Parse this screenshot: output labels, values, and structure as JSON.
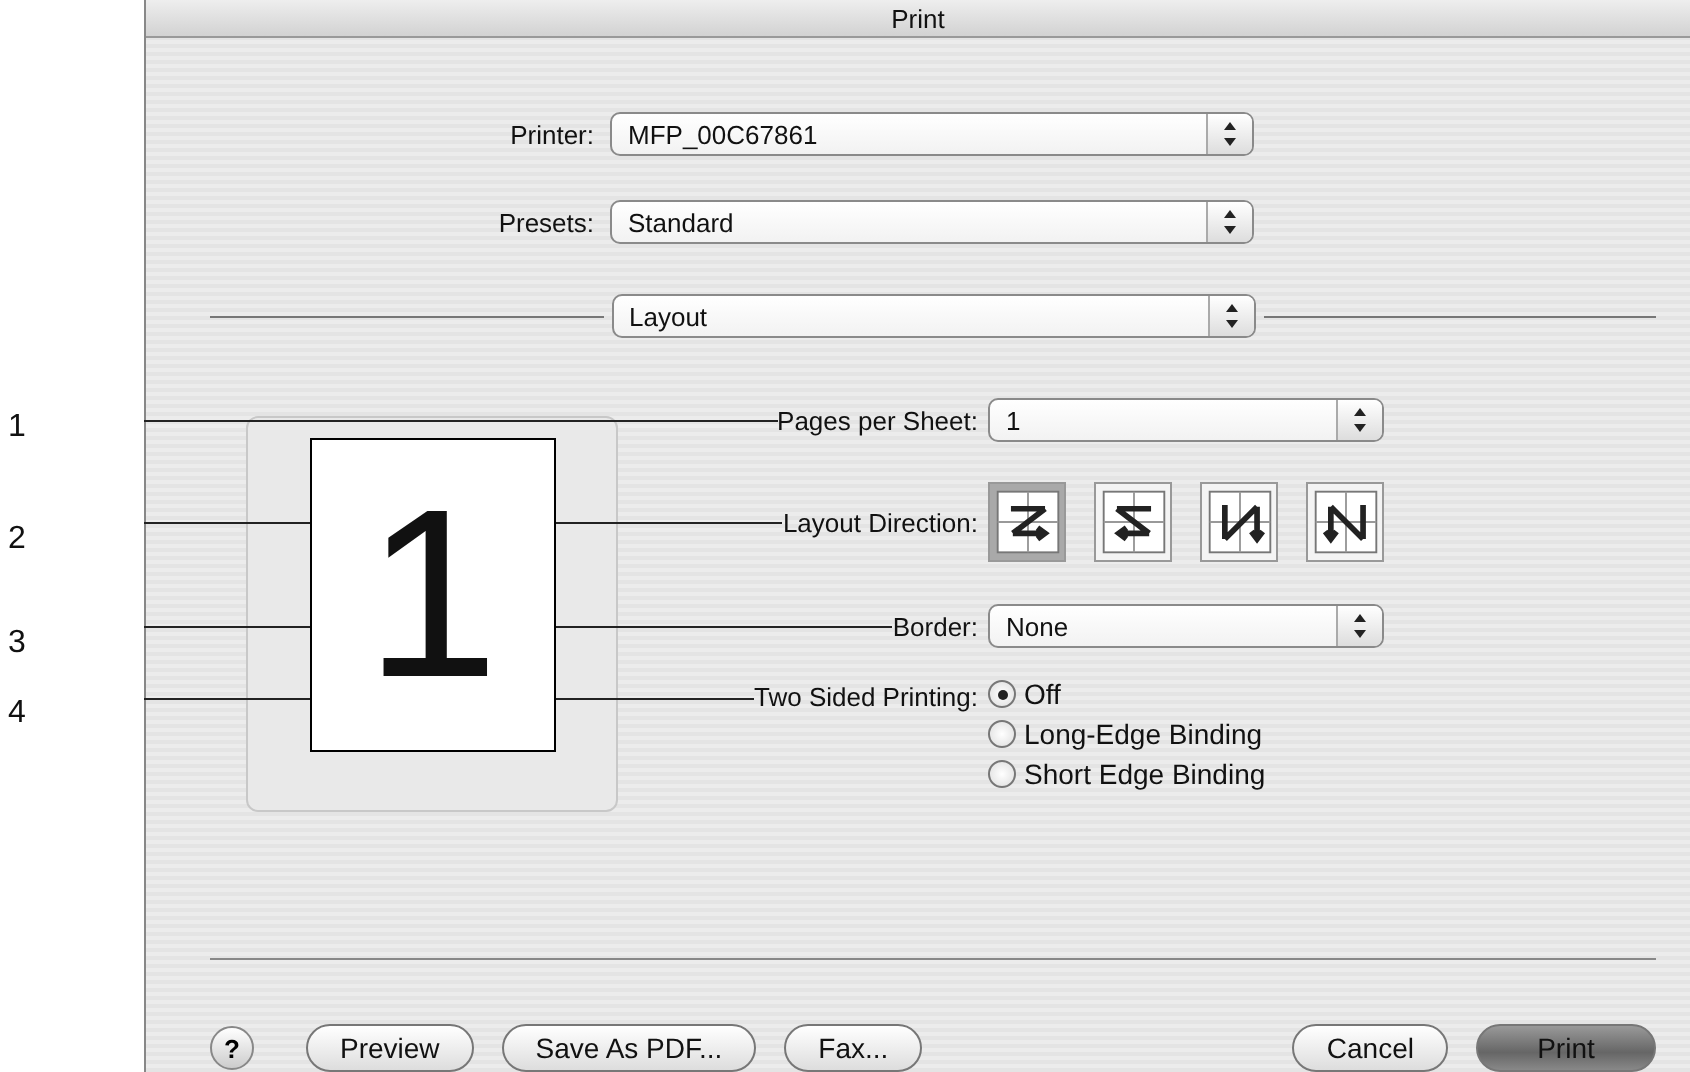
{
  "window": {
    "title": "Print"
  },
  "printer": {
    "label": "Printer:",
    "value": "MFP_00C67861"
  },
  "presets": {
    "label": "Presets:",
    "value": "Standard"
  },
  "panel_menu": {
    "value": "Layout"
  },
  "preview": {
    "page_number": "1"
  },
  "pages_per_sheet": {
    "callout": "1",
    "label": "Pages per Sheet:",
    "value": "1"
  },
  "layout_direction": {
    "callout": "2",
    "label": "Layout Direction:",
    "options": [
      {
        "kind": "z",
        "selected": true
      },
      {
        "kind": "s",
        "selected": false
      },
      {
        "kind": "n",
        "selected": false
      },
      {
        "kind": "n-reverse",
        "selected": false
      }
    ]
  },
  "border": {
    "callout": "3",
    "label": "Border:",
    "value": "None"
  },
  "two_sided": {
    "callout": "4",
    "label": "Two Sided Printing:",
    "options": [
      {
        "label": "Off",
        "selected": true
      },
      {
        "label": "Long-Edge Binding",
        "selected": false
      },
      {
        "label": "Short Edge Binding",
        "selected": false
      }
    ]
  },
  "help": {
    "label": "?"
  },
  "buttons": [
    {
      "label": "Preview",
      "default": false
    },
    {
      "label": "Save As PDF...",
      "default": false
    },
    {
      "label": "Fax...",
      "default": false
    },
    {
      "label": "Cancel",
      "default": false
    },
    {
      "label": "Print",
      "default": true
    }
  ]
}
